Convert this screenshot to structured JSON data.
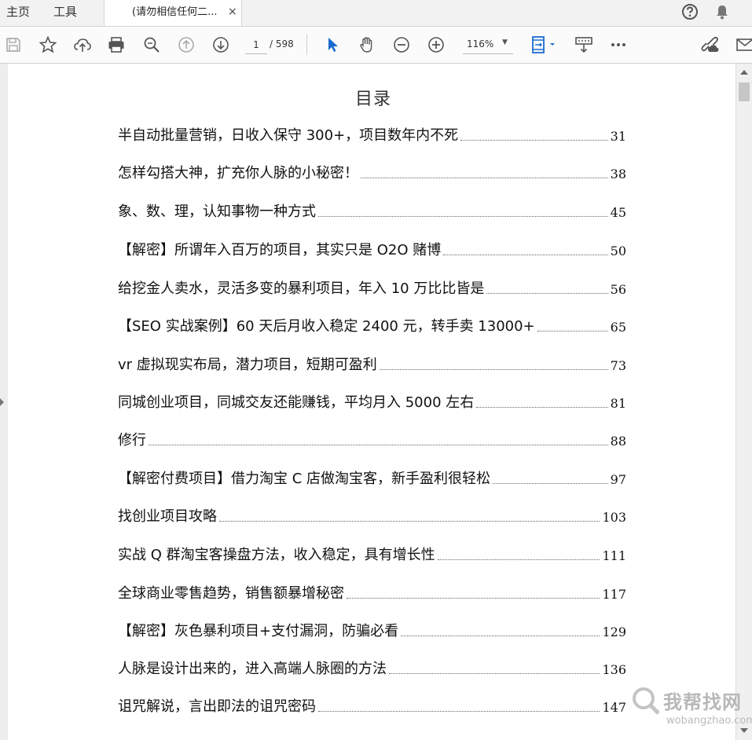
{
  "tabs": {
    "home": "主页",
    "tools": "工具",
    "document": "(请勿相信任何二...",
    "close": "×"
  },
  "toolbar": {
    "page_current": "1",
    "page_total": "/ 598",
    "zoom_value": "116%",
    "icons": [
      "save-icon",
      "bookmark-star-icon",
      "upload-cloud-icon",
      "print-icon",
      "find-zoom-icon",
      "page-up-icon",
      "page-down-icon",
      "select-pointer-icon",
      "hand-icon",
      "zoom-out-icon",
      "zoom-in-icon",
      "fit-page-icon",
      "keyboard-icon",
      "more-icon",
      "share-link-icon",
      "email-icon"
    ]
  },
  "document": {
    "toc_title": "目录",
    "entries": [
      {
        "text": "半自动批量营销，日收入保守 300+，项目数年内不死",
        "page": "31"
      },
      {
        "text": "怎样勾搭大神，扩充你人脉的小秘密！",
        "page": "38"
      },
      {
        "text": "象、数、理，认知事物一种方式",
        "page": "45"
      },
      {
        "text": "【解密】所谓年入百万的项目，其实只是 O2O 赌博",
        "page": "50"
      },
      {
        "text": "给挖金人卖水，灵活多变的暴利项目，年入 10 万比比皆是",
        "page": "56"
      },
      {
        "text": "【SEO 实战案例】60 天后月收入稳定 2400 元，转手卖 13000+",
        "page": "65"
      },
      {
        "text": "vr 虚拟现实布局，潜力项目，短期可盈利",
        "page": "73"
      },
      {
        "text": "同城创业项目，同城交友还能赚钱，平均月入 5000 左右",
        "page": "81"
      },
      {
        "text": "修行",
        "page": "88"
      },
      {
        "text": "【解密付费项目】借力淘宝 C 店做淘宝客，新手盈利很轻松",
        "page": "97"
      },
      {
        "text": "找创业项目攻略",
        "page": "103"
      },
      {
        "text": "实战 Q 群淘宝客操盘方法，收入稳定，具有增长性",
        "page": "111"
      },
      {
        "text": "全球商业零售趋势，销售额暴增秘密",
        "page": "117"
      },
      {
        "text": "【解密】灰色暴利项目+支付漏洞，防骗必看",
        "page": "129"
      },
      {
        "text": "人脉是设计出来的，进入高端人脉圈的方法",
        "page": "136"
      },
      {
        "text": "诅咒解说，言出即法的诅咒密码",
        "page": "147"
      }
    ]
  },
  "watermark": {
    "text": "我帮找网",
    "url": "wobangzhao.com"
  },
  "colors": {
    "accent_blue": "#1a6dd0",
    "icon_gray": "#555555"
  }
}
